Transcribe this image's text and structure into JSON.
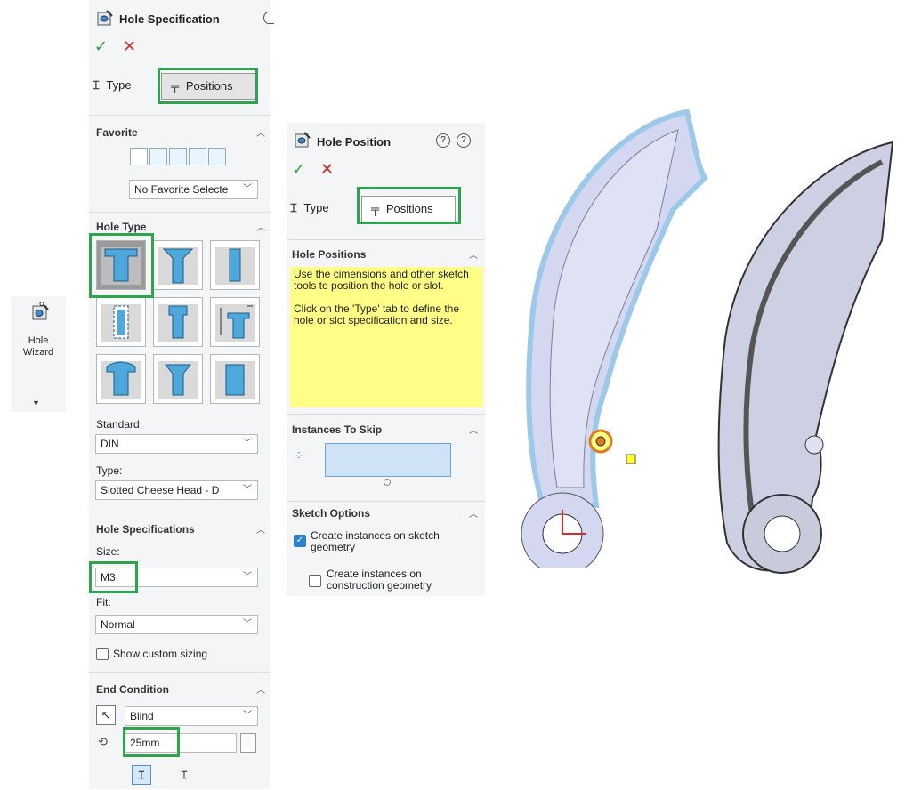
{
  "toolbar": {
    "hole_wizard_label": "Hole Wizard"
  },
  "spec_panel": {
    "title": "Hole Specification",
    "tabs": {
      "type": "Type",
      "positions": "Positions"
    },
    "favorite": {
      "title": "Favorite",
      "select_value": "No Favorite Selecte"
    },
    "hole_type": {
      "title": "Hole Type",
      "tiles": [
        "counterbore",
        "countersink",
        "hole",
        "straight-tap",
        "tapped-hole",
        "legacy-hole",
        "counterbore-slot",
        "countersink-slot",
        "slot"
      ]
    },
    "standard": {
      "label": "Standard:",
      "value": "DIN"
    },
    "type": {
      "label": "Type:",
      "value": "Slotted Cheese Head - D"
    },
    "hole_specs": {
      "title": "Hole Specifications",
      "size_label": "Size:",
      "size_value": "M3",
      "fit_label": "Fit:",
      "fit_value": "Normal",
      "custom_sizing_label": "Show custom sizing",
      "custom_sizing_checked": false
    },
    "end_condition": {
      "title": "End Condition",
      "value": "Blind",
      "depth": "25mm"
    }
  },
  "position_panel": {
    "title": "Hole Position",
    "tabs": {
      "type": "Type",
      "positions": "Positions"
    },
    "hole_positions": {
      "title": "Hole Positions",
      "message_line1": "Use the cimensions and other sketch tools to position the hole or slot.",
      "message_line2": "Click on the 'Type' tab to define the hole or slct specification and size."
    },
    "instances_to_skip": {
      "title": "Instances To Skip"
    },
    "sketch_options": {
      "title": "Sketch Options",
      "opt1_label": "Create instances on sketch geometry",
      "opt1_checked": true,
      "opt2_label": "Create instances on construction geometry",
      "opt2_checked": false
    }
  },
  "colors": {
    "accent_green": "#2ea44f",
    "ok_green": "#2e9e3a",
    "cancel_red": "#d62b2b",
    "note_yellow": "#ffff88",
    "part_fill": "#d3d8f0",
    "part_edge": "#9cc8ea"
  }
}
